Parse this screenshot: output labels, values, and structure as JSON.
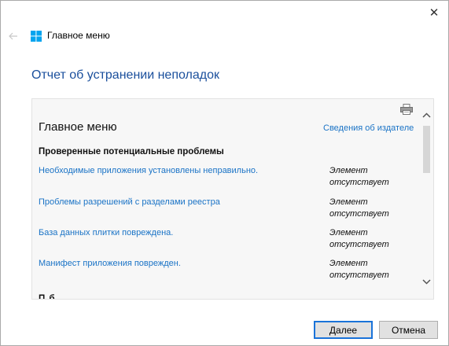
{
  "window": {
    "title": "Главное меню",
    "close_glyph": "✕"
  },
  "heading": "Отчет об устранении неполадок",
  "report": {
    "title": "Главное меню",
    "publisher_link": "Сведения об издателе",
    "section_title": "Проверенные потенциальные проблемы",
    "issues": [
      {
        "label": "Необходимые приложения установлены неправильно.",
        "status_line1": "Элемент",
        "status_line2": "отсутствует"
      },
      {
        "label": "Проблемы разрешений с разделами реестра",
        "status_line1": "Элемент",
        "status_line2": "отсутствует"
      },
      {
        "label": "База данных плитки повреждена.",
        "status_line1": "Элемент",
        "status_line2": "отсутствует"
      },
      {
        "label": "Манифест приложения поврежден.",
        "status_line1": "Элемент",
        "status_line2": "отсутствует"
      }
    ],
    "cut_off_text": "П                                        б"
  },
  "buttons": {
    "next_accel": "Д",
    "next_rest": "алее",
    "cancel": "Отмена"
  },
  "icons": {
    "back": "back-arrow-icon",
    "windows_logo": "windows-logo-icon",
    "print": "print-icon",
    "scroll_up": "chevron-up-icon",
    "scroll_down": "chevron-down-icon"
  },
  "colors": {
    "accent": "#1a73c6",
    "heading": "#1a4f9c",
    "windows_logo": "#00a4ef"
  }
}
